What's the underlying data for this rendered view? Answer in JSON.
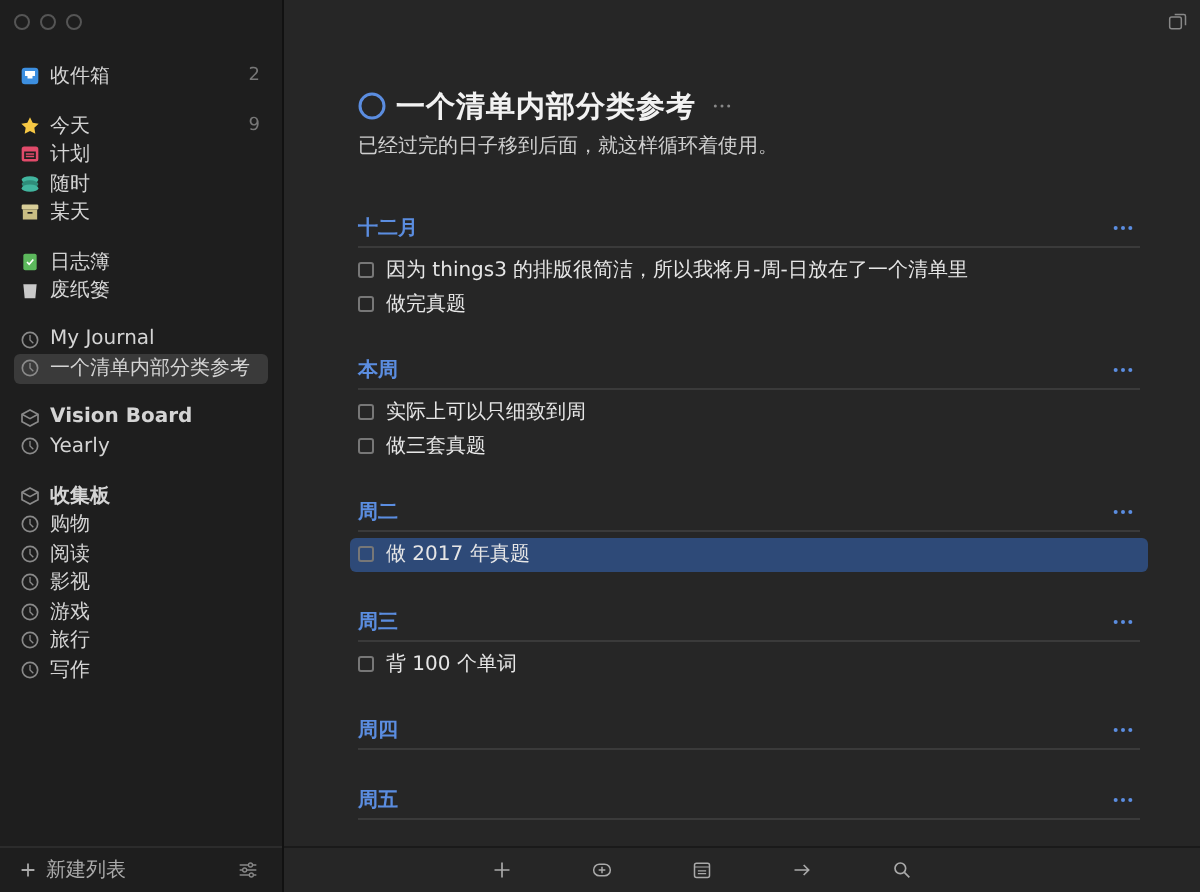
{
  "sidebar": {
    "groups": [
      [
        {
          "label": "收件箱",
          "kind": "inbox",
          "count": "2",
          "selected": false
        }
      ],
      [
        {
          "label": "今天",
          "kind": "today",
          "count": "9",
          "selected": false
        },
        {
          "label": "计划",
          "kind": "upcoming",
          "selected": false
        },
        {
          "label": "随时",
          "kind": "anytime",
          "selected": false
        },
        {
          "label": "某天",
          "kind": "someday",
          "selected": false
        }
      ],
      [
        {
          "label": "日志簿",
          "kind": "logbook",
          "selected": false
        },
        {
          "label": "废纸篓",
          "kind": "trash",
          "selected": false
        }
      ],
      [
        {
          "label": "My Journal",
          "kind": "project",
          "selected": false
        },
        {
          "label": "一个清单内部分类参考",
          "kind": "project",
          "selected": true
        }
      ],
      [
        {
          "label": "Vision Board",
          "kind": "area",
          "selected": false
        },
        {
          "label": "Yearly",
          "kind": "project",
          "selected": false
        }
      ],
      [
        {
          "label": "收集板",
          "kind": "area",
          "selected": false
        },
        {
          "label": "购物",
          "kind": "project",
          "selected": false
        },
        {
          "label": "阅读",
          "kind": "project",
          "selected": false
        },
        {
          "label": "影视",
          "kind": "project",
          "selected": false
        },
        {
          "label": "游戏",
          "kind": "project",
          "selected": false
        },
        {
          "label": "旅行",
          "kind": "project",
          "selected": false
        },
        {
          "label": "写作",
          "kind": "project",
          "selected": false
        }
      ]
    ],
    "new_list": "新建列表"
  },
  "project": {
    "title": "一个清单内部分类参考",
    "note": "已经过完的日子移到后面，就这样循环着使用。",
    "sections": [
      {
        "heading": "十二月",
        "todos": [
          {
            "text": "因为 things3 的排版很简洁，所以我将月-周-日放在了一个清单里",
            "checked": false,
            "selected": false
          },
          {
            "text": "做完真题",
            "checked": false,
            "selected": false
          }
        ]
      },
      {
        "heading": "本周",
        "todos": [
          {
            "text": "实际上可以只细致到周",
            "checked": false,
            "selected": false
          },
          {
            "text": "做三套真题",
            "checked": false,
            "selected": false
          }
        ]
      },
      {
        "heading": "周二",
        "todos": [
          {
            "text": "做 2017 年真题",
            "checked": false,
            "selected": true
          }
        ]
      },
      {
        "heading": "周三",
        "todos": [
          {
            "text": "背 100 个单词",
            "checked": false,
            "selected": false
          }
        ]
      },
      {
        "heading": "周四"
      },
      {
        "heading": "周五"
      }
    ]
  }
}
